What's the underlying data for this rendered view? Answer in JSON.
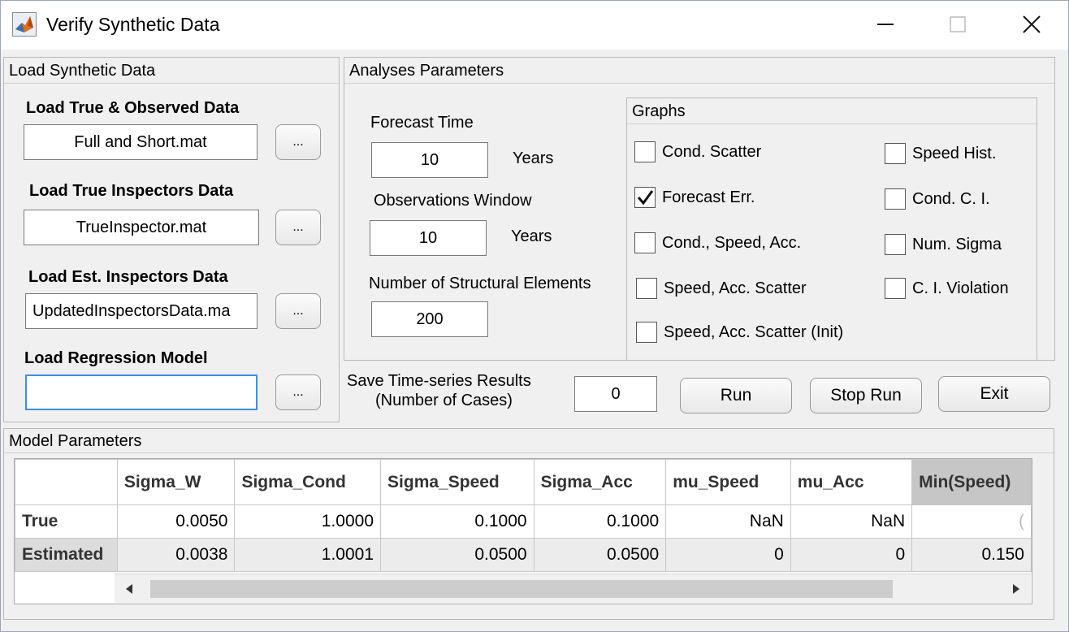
{
  "window": {
    "title": "Verify Synthetic Data"
  },
  "load_panel": {
    "title": "Load Synthetic Data",
    "true_observed": {
      "label": "Load True & Observed Data",
      "value": "Full and Short.mat",
      "browse": "..."
    },
    "true_inspectors": {
      "label": "Load True Inspectors Data",
      "value": "TrueInspector.mat",
      "browse": "..."
    },
    "est_inspectors": {
      "label": "Load Est. Inspectors Data",
      "value": "UpdatedInspectorsData.ma",
      "browse": "..."
    },
    "regression": {
      "label": "Load Regression Model",
      "value": "",
      "browse": "..."
    }
  },
  "analyses_panel": {
    "title": "Analyses Parameters",
    "forecast_time": {
      "label": "Forecast Time",
      "value": "10",
      "unit": "Years"
    },
    "obs_window": {
      "label": "Observations Window",
      "value": "10",
      "unit": "Years"
    },
    "num_elements": {
      "label": "Number of Structural Elements",
      "value": "200"
    }
  },
  "graphs_panel": {
    "title": "Graphs",
    "items": [
      {
        "label": "Cond. Scatter",
        "checked": false
      },
      {
        "label": "Forecast Err.",
        "checked": true
      },
      {
        "label": "Cond., Speed, Acc.",
        "checked": false
      },
      {
        "label": "Speed, Acc. Scatter",
        "checked": false
      },
      {
        "label": "Speed, Acc. Scatter (Init)",
        "checked": false
      },
      {
        "label": "Speed Hist.",
        "checked": false
      },
      {
        "label": "Cond. C. I.",
        "checked": false
      },
      {
        "label": "Num. Sigma",
        "checked": false
      },
      {
        "label": "C. I. Violation",
        "checked": false
      }
    ]
  },
  "save_results": {
    "label_line1": "Save Time-series Results",
    "label_line2": "(Number of Cases)",
    "value": "0"
  },
  "actions": {
    "run": "Run",
    "stop_run": "Stop Run",
    "exit": "Exit"
  },
  "model_panel": {
    "title": "Model Parameters",
    "columns": [
      "Sigma_W",
      "Sigma_Cond",
      "Sigma_Speed",
      "Sigma_Acc",
      "mu_Speed",
      "mu_Acc",
      "Min(Speed)"
    ],
    "rows": [
      {
        "name": "True",
        "values": [
          "0.0050",
          "1.0000",
          "0.1000",
          "0.1000",
          "NaN",
          "NaN",
          "("
        ]
      },
      {
        "name": "Estimated",
        "values": [
          "0.0038",
          "1.0001",
          "0.0500",
          "0.0500",
          "0",
          "0",
          "0.150"
        ]
      }
    ]
  },
  "icons": {
    "app": "matlab-logo-icon",
    "minimize": "minimize-icon",
    "maximize": "maximize-icon",
    "close": "close-icon",
    "check": "checkmark-icon",
    "scroll_left": "scroll-left-arrow-icon",
    "scroll_right": "scroll-right-arrow-icon"
  }
}
